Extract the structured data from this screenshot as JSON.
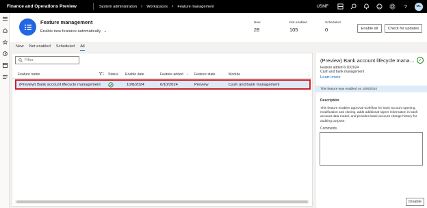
{
  "topbar": {
    "app_title": "Finance and Operations Preview",
    "breadcrumb": [
      "System administration",
      "Workspaces",
      "Feature management"
    ],
    "company": "USMF",
    "avatar_initials": "ML"
  },
  "header": {
    "title": "Feature management",
    "subtitle": "Enable new features automatically",
    "stats": [
      {
        "label": "New",
        "value": "28"
      },
      {
        "label": "Not enabled",
        "value": "105"
      },
      {
        "label": "Scheduled",
        "value": "0"
      }
    ],
    "enable_all_label": "Enable all",
    "check_updates_label": "Check for updates"
  },
  "tabs": [
    {
      "label": "New",
      "active": false
    },
    {
      "label": "Not enabled",
      "active": false
    },
    {
      "label": "Scheduled",
      "active": false
    },
    {
      "label": "All",
      "active": true
    }
  ],
  "grid": {
    "filter_placeholder": "Filter",
    "columns": [
      "Feature name",
      "Status",
      "Enable date",
      "Feature added",
      "Feature state",
      "Module"
    ],
    "rows": [
      {
        "feature_name": "(Preview) Bank account lifecycle management",
        "status": "enabled",
        "enable_date": "10/8/2024",
        "feature_added": "6/10/2024",
        "feature_state": "Preview",
        "module": "Cash and bank management"
      }
    ]
  },
  "details": {
    "title": "(Preview) Bank account lifecycle management",
    "feature_added": "Feature added 6/10/2024",
    "module": "Cash and bank management",
    "learn_more": "Learn more",
    "banner": "This feature was enabled on 10/8/2024",
    "description_label": "Description",
    "description": "This feature enables approval workflow for bank account opening, modification and closing, adds additional signer information in bank account data model, and provides bank account change history for auditing purpose.",
    "comments_label": "Comments",
    "disable_label": "Disable"
  },
  "colors": {
    "accent": "#2266e3",
    "selected_row": "#dce9f7",
    "highlight_border": "#d1212b",
    "enabled_green": "#107c10"
  }
}
